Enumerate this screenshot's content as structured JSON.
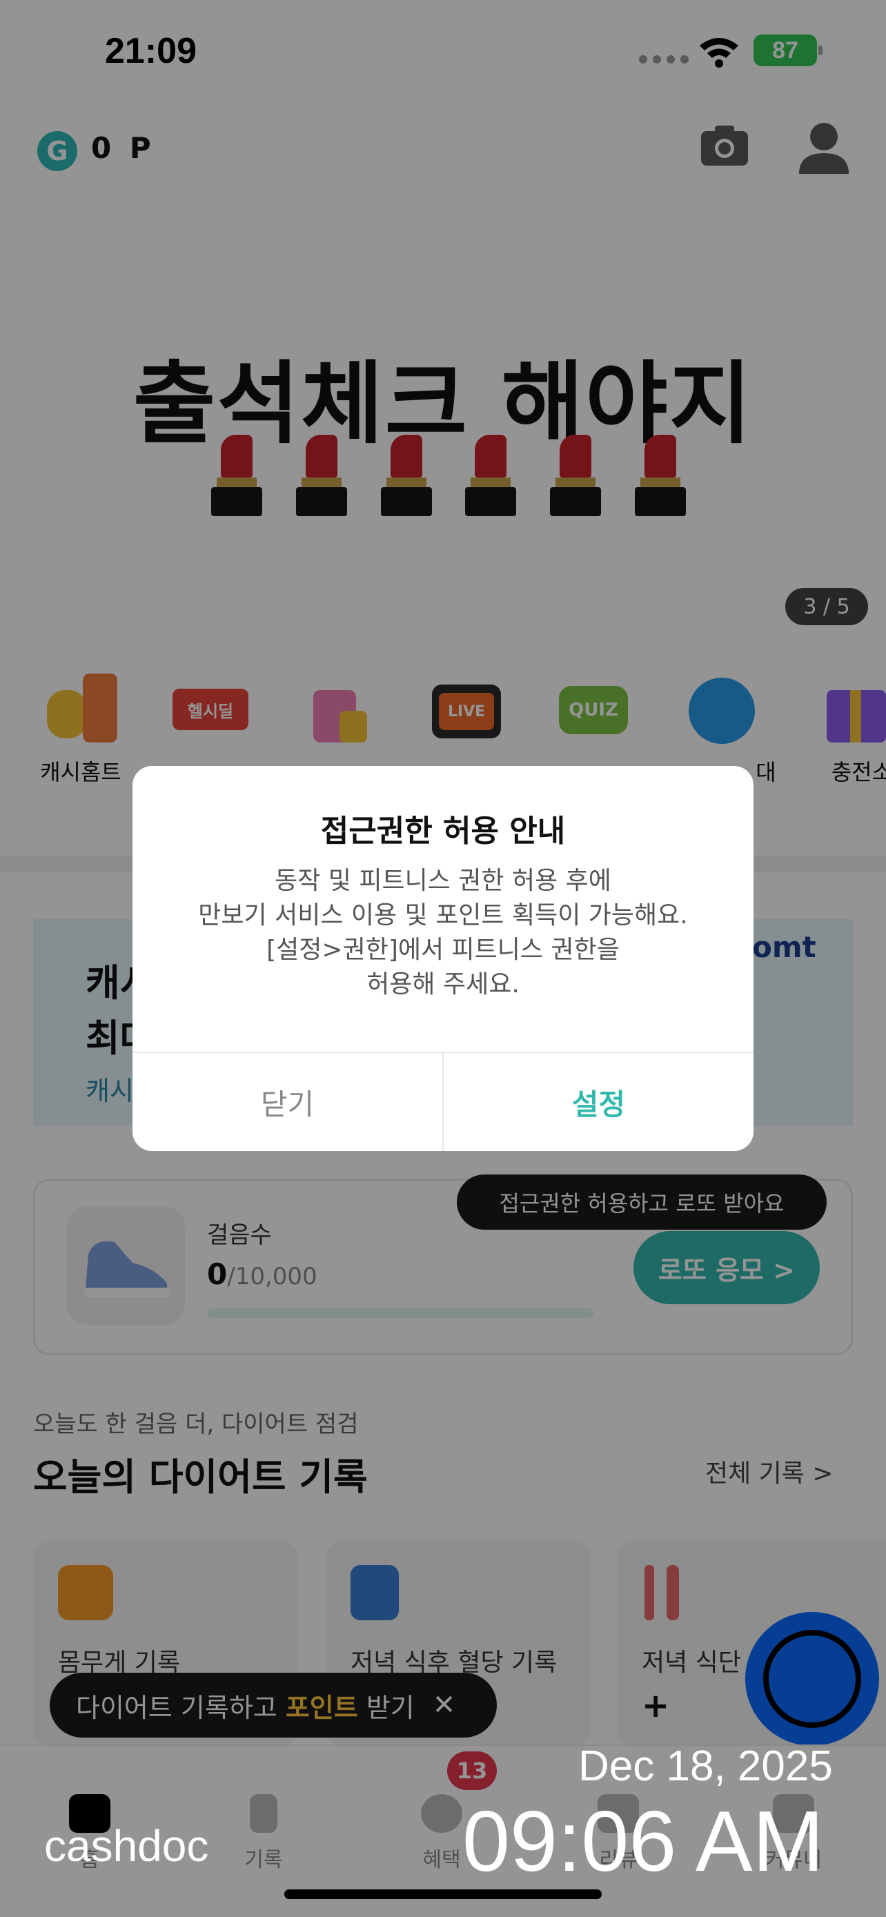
{
  "status": {
    "time": "21:09",
    "battery": "87"
  },
  "header": {
    "logo": "G",
    "points": "0 P",
    "icons": [
      "camera-icon",
      "profile-icon"
    ]
  },
  "banner": {
    "title": "출석체크 해야지",
    "pager": "3 / 5"
  },
  "shortcuts": [
    {
      "label": "캐시홈트",
      "icon": "kettlebell-icon"
    },
    {
      "label": "",
      "icon": "healthy-deal-icon"
    },
    {
      "label": "",
      "icon": "shopping-bag-icon"
    },
    {
      "label": "",
      "icon": "live-tv-icon"
    },
    {
      "label": "",
      "icon": "quiz-icon"
    },
    {
      "label": "대",
      "icon": "invite-friend-icon"
    },
    {
      "label": "충전소",
      "icon": "gift-icon"
    }
  ],
  "shortcut_badges": {
    "healthy": "헬시딜",
    "live": "LIVE",
    "quiz": "QUIZ"
  },
  "ad": {
    "line1": "캐시",
    "line2": "최대",
    "line3": "캐시",
    "brand": "omt"
  },
  "steps": {
    "label": "걸음수",
    "count": "0",
    "max": "/10,000",
    "button": "로또 응모 >",
    "tooltip": "접근권한 허용하고 로또 받아요"
  },
  "diet": {
    "subtitle": "오늘도 한 걸음 더, 다이어트 점검",
    "title": "오늘의 다이어트 기록",
    "view_all": "전체 기록 >",
    "cards": [
      {
        "label": "몸무게 기록",
        "icon": "scale-icon"
      },
      {
        "label": "저녁 식후 혈당 기록",
        "icon": "glucose-meter-icon"
      },
      {
        "label": "저녁 식단",
        "icon": "fork-knife-icon"
      }
    ],
    "plus": "+",
    "tip_prefix": "다이어트 기록하고 ",
    "tip_highlight": "포인트",
    "tip_suffix": " 받기",
    "tip_close": "✕"
  },
  "nav": [
    {
      "label": "홈",
      "icon": "home-icon"
    },
    {
      "label": "기록",
      "icon": "pencil-icon"
    },
    {
      "label": "혜택",
      "icon": "benefit-icon"
    },
    {
      "label": "리뷰",
      "icon": "review-icon"
    },
    {
      "label": "커뮤니",
      "icon": "community-icon"
    }
  ],
  "nav_badge": "13",
  "dialog": {
    "title": "접근권한 허용 안내",
    "body_lines": [
      "동작 및 피트니스 권한 허용 후에",
      "만보기 서비스 이용 및 포인트 획득이 가능해요.",
      "[설정>권한]에서 피트니스 권한을",
      "허용해 주세요."
    ],
    "close": "닫기",
    "settings": "설정"
  },
  "watermark": {
    "date": "Dec 18, 2025",
    "time": "09:06 AM",
    "brand": "cashdoc"
  },
  "colors": {
    "accent": "#33b8ad",
    "badge": "#e8384f",
    "fab": "#0a6cff",
    "battery": "#34c759"
  }
}
